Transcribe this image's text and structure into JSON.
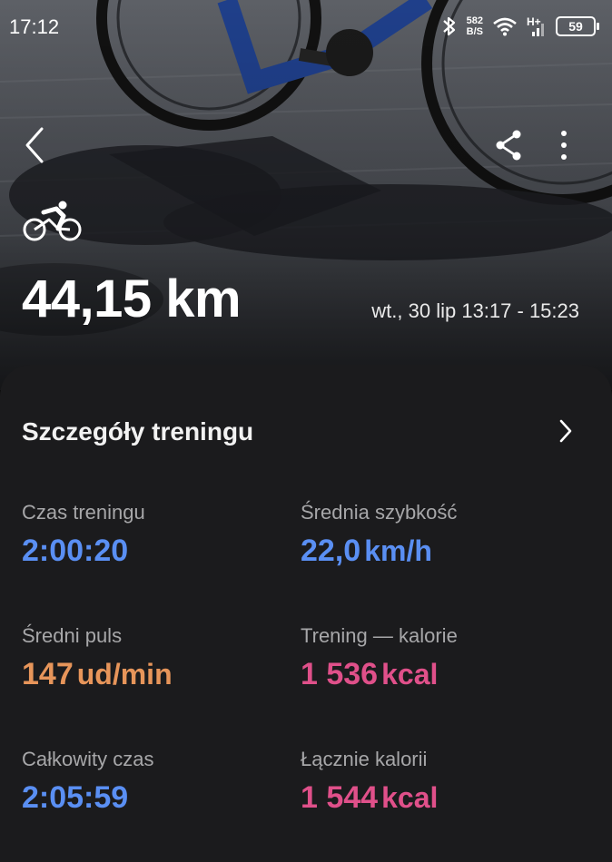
{
  "status_bar": {
    "time": "17:12",
    "net_speed_value": "582",
    "net_speed_unit": "B/S",
    "network_type": "H+",
    "battery": "59"
  },
  "toolbar": {
    "back_icon": "chevron-left-icon",
    "share_icon": "share-icon",
    "more_icon": "more-vertical-icon"
  },
  "workout": {
    "sport_icon": "cycling-icon",
    "distance": "44,15 km",
    "date_range": "wt., 30 lip 13:17 - 15:23"
  },
  "details": {
    "title": "Szczegóły treningu",
    "stats": [
      {
        "label": "Czas treningu",
        "value": "2:00:20",
        "unit": ""
      },
      {
        "label": "Średnia szybkość",
        "value": "22,0",
        "unit": "km/h"
      },
      {
        "label": "Średni puls",
        "value": "147",
        "unit": "ud/min"
      },
      {
        "label": "Trening — kalorie",
        "value": "1 536",
        "unit": "kcal"
      },
      {
        "label": "Całkowity czas",
        "value": "2:05:59",
        "unit": ""
      },
      {
        "label": "Łącznie kalorii",
        "value": "1 544",
        "unit": "kcal"
      }
    ]
  },
  "colors": {
    "time_value": "#5a8ff3",
    "heart_rate_value": "#e7955a",
    "calorie_value": "#e0508a",
    "card_background": "#1b1b1d"
  }
}
